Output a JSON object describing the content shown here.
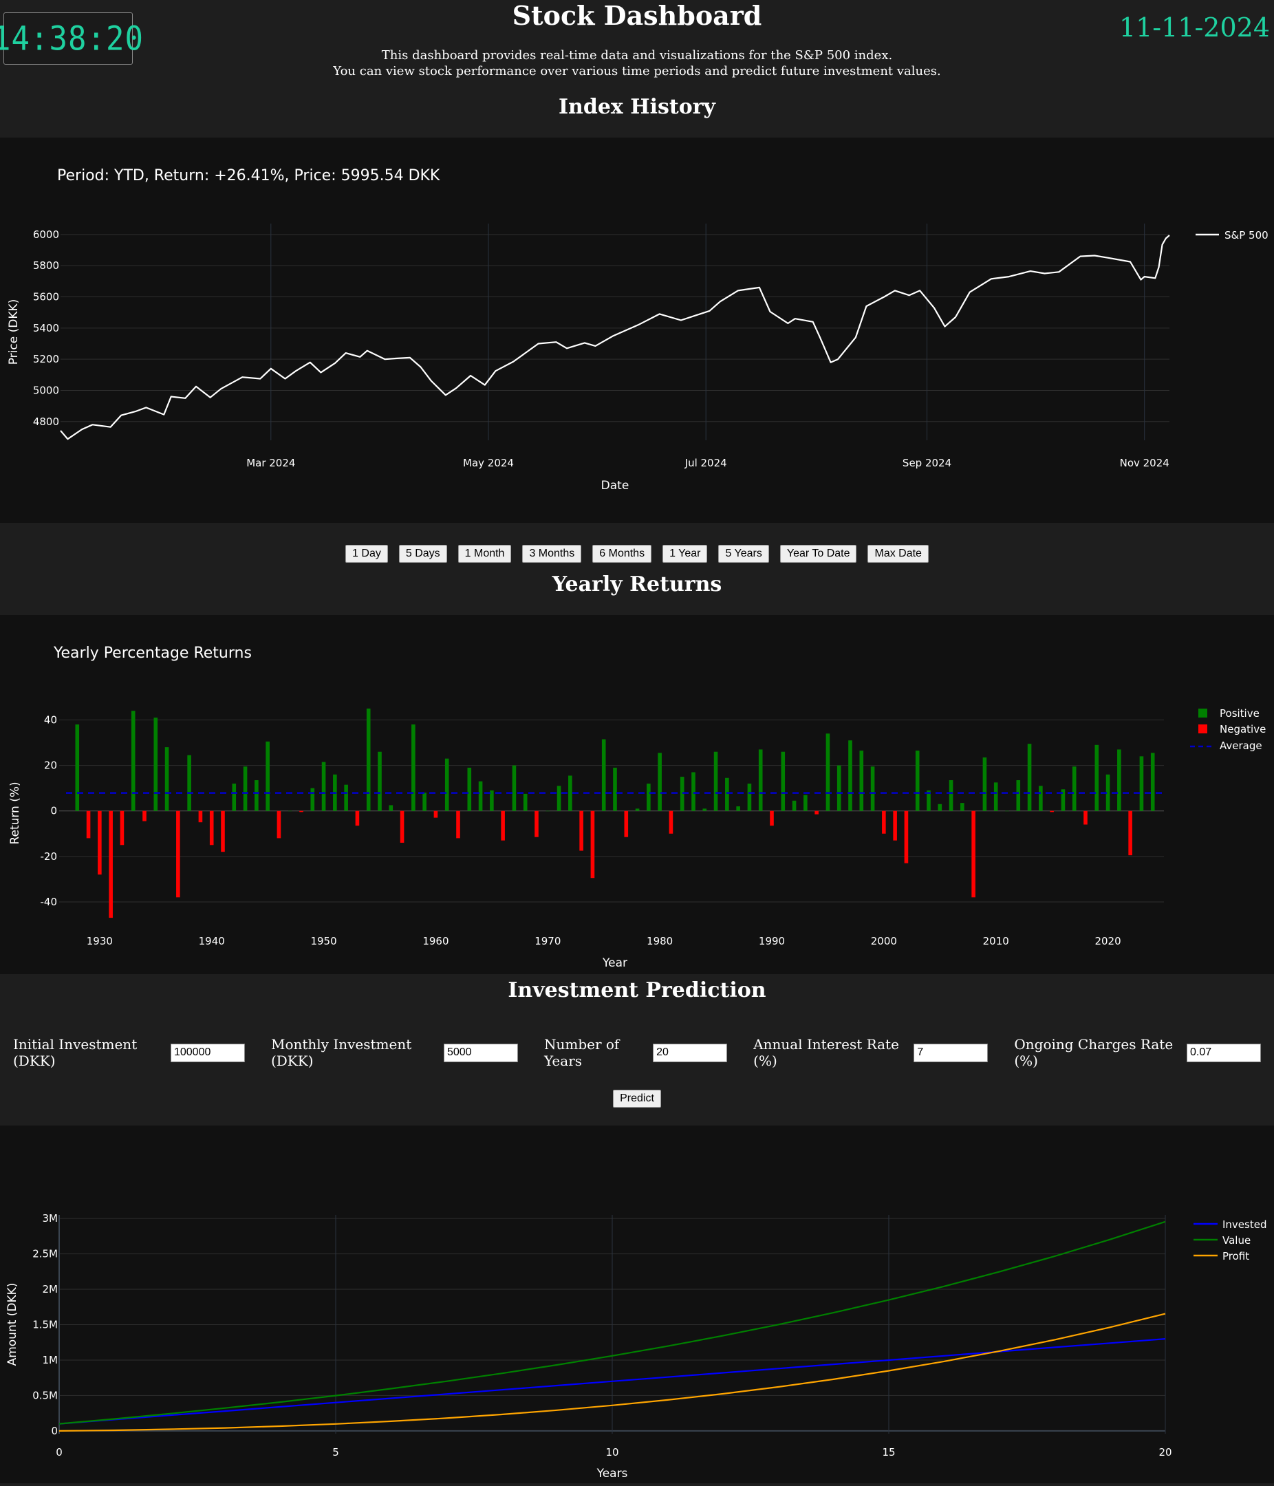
{
  "header": {
    "clock": "14:38:20",
    "title": "Stock Dashboard",
    "date": "11-11-2024",
    "desc_line1": "This dashboard provides real-time data and visualizations for the S&P 500 index.",
    "desc_line2": "You can view stock performance over various time periods and predict future investment values."
  },
  "sections": {
    "index_history": "Index History",
    "yearly_returns": "Yearly Returns",
    "investment_prediction": "Investment Prediction"
  },
  "period_buttons": [
    "1 Day",
    "5 Days",
    "1 Month",
    "3 Months",
    "6 Months",
    "1 Year",
    "5 Years",
    "Year To Date",
    "Max Date"
  ],
  "form": {
    "fields": [
      {
        "label": "Initial Investment (DKK)",
        "value": "100000"
      },
      {
        "label": "Monthly Investment (DKK)",
        "value": "5000"
      },
      {
        "label": "Number of Years",
        "value": "20"
      },
      {
        "label": "Annual Interest Rate (%)",
        "value": "7"
      },
      {
        "label": "Ongoing Charges Rate (%)",
        "value": "0.07"
      }
    ],
    "predict_label": "Predict"
  },
  "chart_data": [
    {
      "type": "line",
      "title": "Period: YTD, Return: +26.41%, Price: 5995.54 DKK",
      "xlabel": "Date",
      "ylabel": "Price (DKK)",
      "xtick_labels": [
        "Mar 2024",
        "May 2024",
        "Jul 2024",
        "Sep 2024",
        "Nov 2024"
      ],
      "xtick_dates": [
        "2024-03-01",
        "2024-05-01",
        "2024-07-01",
        "2024-09-01",
        "2024-11-01"
      ],
      "xlim": [
        "2024-01-02",
        "2024-11-08"
      ],
      "yticks": [
        4800,
        5000,
        5200,
        5400,
        5600,
        5800,
        6000
      ],
      "ylim": [
        4680,
        6070
      ],
      "grid": true,
      "legend_position": "top-right",
      "color": "#ffffff",
      "series": [
        {
          "name": "S&P 500",
          "dates": [
            "2024-01-02",
            "2024-01-04",
            "2024-01-08",
            "2024-01-11",
            "2024-01-16",
            "2024-01-19",
            "2024-01-23",
            "2024-01-26",
            "2024-01-31",
            "2024-02-02",
            "2024-02-06",
            "2024-02-09",
            "2024-02-13",
            "2024-02-16",
            "2024-02-22",
            "2024-02-27",
            "2024-03-01",
            "2024-03-05",
            "2024-03-08",
            "2024-03-12",
            "2024-03-15",
            "2024-03-19",
            "2024-03-22",
            "2024-03-26",
            "2024-03-28",
            "2024-04-02",
            "2024-04-05",
            "2024-04-09",
            "2024-04-12",
            "2024-04-15",
            "2024-04-19",
            "2024-04-22",
            "2024-04-26",
            "2024-04-30",
            "2024-05-03",
            "2024-05-08",
            "2024-05-15",
            "2024-05-20",
            "2024-05-23",
            "2024-05-28",
            "2024-05-31",
            "2024-06-05",
            "2024-06-12",
            "2024-06-18",
            "2024-06-24",
            "2024-06-28",
            "2024-07-02",
            "2024-07-05",
            "2024-07-10",
            "2024-07-16",
            "2024-07-19",
            "2024-07-24",
            "2024-07-26",
            "2024-07-31",
            "2024-08-02",
            "2024-08-05",
            "2024-08-07",
            "2024-08-12",
            "2024-08-15",
            "2024-08-20",
            "2024-08-23",
            "2024-08-27",
            "2024-08-30",
            "2024-09-03",
            "2024-09-06",
            "2024-09-09",
            "2024-09-13",
            "2024-09-19",
            "2024-09-24",
            "2024-09-30",
            "2024-10-04",
            "2024-10-08",
            "2024-10-14",
            "2024-10-18",
            "2024-10-22",
            "2024-10-28",
            "2024-10-31",
            "2024-11-01",
            "2024-11-04",
            "2024-11-05",
            "2024-11-06",
            "2024-11-07",
            "2024-11-08"
          ],
          "values": [
            4742,
            4688,
            4750,
            4780,
            4765,
            4840,
            4865,
            4890,
            4845,
            4960,
            4950,
            5025,
            4955,
            5010,
            5085,
            5075,
            5140,
            5075,
            5125,
            5180,
            5115,
            5175,
            5240,
            5215,
            5255,
            5200,
            5205,
            5210,
            5150,
            5060,
            4970,
            5015,
            5095,
            5035,
            5125,
            5185,
            5300,
            5310,
            5270,
            5305,
            5285,
            5350,
            5420,
            5490,
            5450,
            5480,
            5510,
            5570,
            5640,
            5660,
            5505,
            5430,
            5460,
            5440,
            5340,
            5180,
            5200,
            5340,
            5540,
            5600,
            5640,
            5610,
            5640,
            5530,
            5410,
            5470,
            5630,
            5715,
            5730,
            5765,
            5750,
            5760,
            5860,
            5865,
            5850,
            5825,
            5710,
            5730,
            5720,
            5790,
            5935,
            5975,
            5995
          ]
        }
      ]
    },
    {
      "type": "bar",
      "title": "Yearly Percentage Returns",
      "xlabel": "Year",
      "ylabel": "Return (%)",
      "xticks": [
        1930,
        1940,
        1950,
        1960,
        1970,
        1980,
        1990,
        2000,
        2010,
        2020
      ],
      "yticks": [
        -40,
        -20,
        0,
        20,
        40
      ],
      "ylim": [
        -50,
        48
      ],
      "xlim": [
        1927,
        2025
      ],
      "grid": true,
      "legend_position": "top-right",
      "years": [
        1928,
        1929,
        1930,
        1931,
        1932,
        1933,
        1934,
        1935,
        1936,
        1937,
        1938,
        1939,
        1940,
        1941,
        1942,
        1943,
        1944,
        1945,
        1946,
        1947,
        1948,
        1949,
        1950,
        1951,
        1952,
        1953,
        1954,
        1955,
        1956,
        1957,
        1958,
        1959,
        1960,
        1961,
        1962,
        1963,
        1964,
        1965,
        1966,
        1967,
        1968,
        1969,
        1970,
        1971,
        1972,
        1973,
        1974,
        1975,
        1976,
        1977,
        1978,
        1979,
        1980,
        1981,
        1982,
        1983,
        1984,
        1985,
        1986,
        1987,
        1988,
        1989,
        1990,
        1991,
        1992,
        1993,
        1994,
        1995,
        1996,
        1997,
        1998,
        1999,
        2000,
        2001,
        2002,
        2003,
        2004,
        2005,
        2006,
        2007,
        2008,
        2009,
        2010,
        2011,
        2012,
        2013,
        2014,
        2015,
        2016,
        2017,
        2018,
        2019,
        2020,
        2021,
        2022,
        2023,
        2024
      ],
      "values": [
        38,
        -12,
        -28,
        -47,
        -15,
        44,
        -4.5,
        41,
        28,
        -38,
        24.5,
        -5,
        -15,
        -18,
        12,
        19.5,
        13.5,
        30.5,
        -12,
        0,
        -0.5,
        10,
        21.5,
        16,
        11.5,
        -6.5,
        45,
        26,
        2.5,
        -14,
        38,
        8,
        -3,
        23,
        -12,
        19,
        13,
        9,
        -13,
        20,
        7.5,
        -11.5,
        0,
        11,
        15.5,
        -17.5,
        -29.5,
        31.5,
        19,
        -11.5,
        1,
        12,
        25.5,
        -10,
        15,
        17,
        1,
        26,
        14.5,
        2,
        12,
        27,
        -6.5,
        26,
        4.5,
        7,
        -1.5,
        34,
        20,
        31,
        26.5,
        19.5,
        -10,
        -13,
        -23,
        26.5,
        9,
        3,
        13.5,
        3.5,
        -38,
        23.5,
        12.5,
        0,
        13.5,
        29.5,
        11,
        -0.5,
        9.5,
        19.5,
        -6,
        29,
        16,
        27,
        -19.5,
        24,
        25.5
      ],
      "series": [
        {
          "name": "Positive",
          "color": "#008000"
        },
        {
          "name": "Negative",
          "color": "#ff0000"
        },
        {
          "name": "Average",
          "color": "#0000cc",
          "value": 7.9
        }
      ]
    },
    {
      "type": "line",
      "title": "",
      "xlabel": "Years",
      "ylabel": "Amount (DKK)",
      "xticks": [
        0,
        5,
        10,
        15,
        20
      ],
      "ytick_labels": [
        "0",
        "0.5M",
        "1M",
        "1.5M",
        "2M",
        "2.5M",
        "3M"
      ],
      "ytick_values": [
        0,
        500000,
        1000000,
        1500000,
        2000000,
        2500000,
        3000000
      ],
      "xlim": [
        0,
        20
      ],
      "ylim": [
        -40000,
        3050000
      ],
      "grid": true,
      "legend_position": "top-right",
      "x": [
        0,
        1,
        2,
        3,
        4,
        5,
        6,
        7,
        8,
        9,
        10,
        11,
        12,
        13,
        14,
        15,
        16,
        17,
        18,
        19,
        20
      ],
      "series": [
        {
          "name": "Invested",
          "color": "#0000ff",
          "values": [
            100000,
            160000,
            220000,
            280000,
            340000,
            400000,
            460000,
            520000,
            580000,
            640000,
            700000,
            760000,
            820000,
            880000,
            940000,
            1000000,
            1060000,
            1120000,
            1180000,
            1240000,
            1300000
          ]
        },
        {
          "name": "Value",
          "color": "#008000",
          "values": [
            100000,
            169000,
            243000,
            322000,
            407000,
            498000,
            596000,
            700000,
            812000,
            932000,
            1060000,
            1197000,
            1344000,
            1501000,
            1669000,
            1849000,
            2041000,
            2247000,
            2467000,
            2703000,
            2955000
          ]
        },
        {
          "name": "Profit",
          "color": "#ffa500",
          "values": [
            0,
            9000,
            23000,
            42000,
            67000,
            98000,
            136000,
            180000,
            232000,
            292000,
            360000,
            437000,
            524000,
            621000,
            729000,
            849000,
            981000,
            1127000,
            1287000,
            1463000,
            1655000
          ]
        }
      ]
    }
  ]
}
